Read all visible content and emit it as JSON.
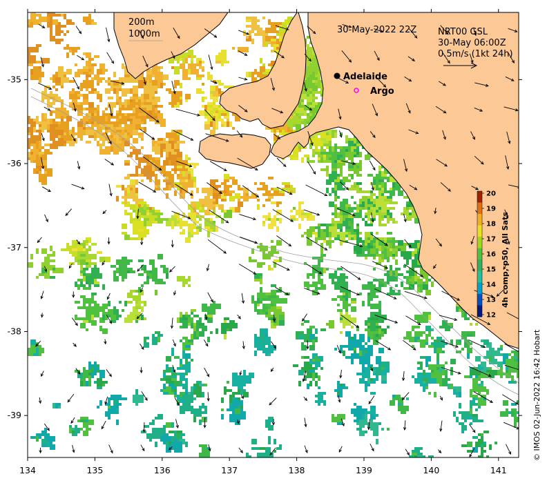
{
  "map": {
    "timestamp_label": "30-May-2022 22Z",
    "depth_contours": {
      "shallow": "200m",
      "deep": "1000m"
    },
    "current_info": {
      "line1": "NRT00 GSL",
      "line2": "30-May 06:00Z",
      "line3": "0.5m/s (1kt 24h)"
    },
    "places": [
      {
        "name": "Adelaide",
        "lon": 138.6,
        "lat": -34.93,
        "marker": "filled-dot"
      },
      {
        "name": "Argo",
        "lon": 138.8,
        "lat": -35.12,
        "marker": "magenta-circle"
      }
    ],
    "credit": "© IMOS 02-Jun-2022 16:42 Hobart",
    "colors": {
      "land": "#fbc896",
      "coast": "#000000",
      "contour": "#a0a0a0",
      "argo": "#ff00ff",
      "background": "#ffffff"
    }
  },
  "axes": {
    "x_ticks": [
      "134",
      "135",
      "136",
      "137",
      "138",
      "139",
      "140",
      "141"
    ],
    "y_ticks": [
      "-35",
      "-36",
      "-37",
      "-38",
      "-39"
    ],
    "lon_range": [
      134,
      141.3
    ],
    "lat_range": [
      -39.5,
      -34.2
    ]
  },
  "colorbar": {
    "title": "4h comp, p50, All Sats",
    "ticks": [
      "20",
      "19",
      "18",
      "17",
      "16",
      "15",
      "14",
      "13",
      "12"
    ],
    "range": [
      12,
      20
    ],
    "colors": [
      "#001a80",
      "#0050c8",
      "#00a0d0",
      "#20c0a0",
      "#30b060",
      "#50c040",
      "#a0d820",
      "#e8e020",
      "#f0b020",
      "#e07010",
      "#a02000"
    ]
  }
}
